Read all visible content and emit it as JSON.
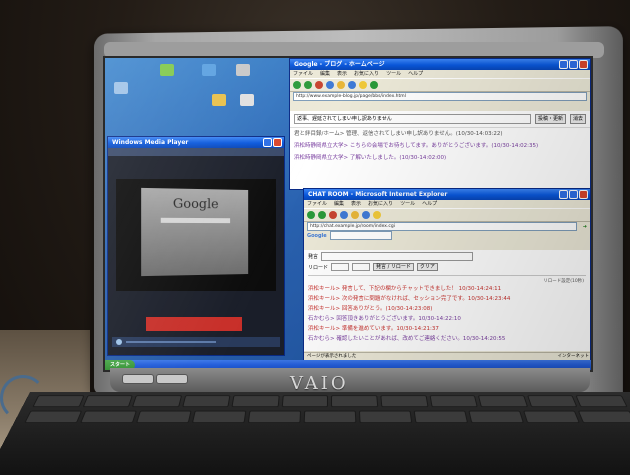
{
  "screen": {
    "laptop_brand": "VAIO",
    "desktop_icons": [
      {
        "label": "",
        "color": "#7fc84a"
      },
      {
        "label": "",
        "color": "#5aa0e0"
      },
      {
        "label": "",
        "color": "#c8c8c8"
      },
      {
        "label": "",
        "color": "#e8c04a"
      },
      {
        "label": "",
        "color": "#e0e0e0"
      }
    ],
    "browser_main": {
      "title": "Google - ブログ - ホームページ",
      "menu": [
        "ファイル",
        "編集",
        "表示",
        "お気に入り",
        "ツール",
        "ヘルプ"
      ],
      "address": "http://www.example-blog.jp/page/bbs/index.html",
      "notice": "返事、遅延されてしまい申し訳ありません",
      "notice_buttons": [
        "投稿・更新",
        "消去"
      ],
      "chat_lines": [
        {
          "author": "君と絆目録/ホーム",
          "text": "> 管理、返信されてしまい申し訳ありません。(10/30-14:03:22)",
          "color": "#555555"
        },
        {
          "author": "浜松時静岡県立大学",
          "text": "> こちらの会場でお待ちしてます。ありがとうございます。(10/30-14:02:35)",
          "color": "#7a3fa0"
        },
        {
          "author": "浜松時静岡県立大学",
          "text": "> 了解いたしました。(10/30-14:02:00)",
          "color": "#7a3fa0"
        }
      ]
    },
    "media_window": {
      "title": "Windows Media Player",
      "logo": "Google"
    },
    "chat_window": {
      "title": "CHAT ROOM - Microsoft Internet Explorer",
      "menu": [
        "ファイル",
        "編集",
        "表示",
        "お気に入り",
        "ツール",
        "ヘルプ"
      ],
      "address": "http://chat.example.jp/room/index.cgi",
      "search_label": "Google",
      "name_label": "発言",
      "name_value": "",
      "reload_label": "リロード",
      "send_button": "発言 / リロード",
      "clear_button": "クリア",
      "reload_interval_label": "リロード設定(10秒)",
      "messages": [
        {
          "author": "浜松キール",
          "text": "> 発言して、下記の欄からチャットできました！ 10/30-14:24:11",
          "color": "#c9332f"
        },
        {
          "author": "浜松キール",
          "text": "> 次の発言に問題がなければ、セッション完了です。10/30-14:23:44",
          "color": "#c9332f"
        },
        {
          "author": "浜松キール",
          "text": "> 回答ありがとう。(10/30-14:23:08)",
          "color": "#c9332f"
        },
        {
          "author": "石かむら",
          "text": "> 回答頂きありがとうございます。10/30-14:22:10",
          "color": "#7a3fa0"
        },
        {
          "author": "浜松キール",
          "text": "> 準備を進めています。10/30-14:21:37",
          "color": "#c9332f"
        },
        {
          "author": "石かむら",
          "text": "> 確認したいことがあれば、改めてご連絡ください。10/30-14:20:55",
          "color": "#7a3fa0"
        },
        {
          "author": "石かむら",
          "text": "> 了解です。10/30-14:20:12",
          "color": "#7a3fa0"
        }
      ],
      "status": "ページが表示されました",
      "zone": "インターネット"
    },
    "taskbar": {
      "start_label": "スタート"
    }
  }
}
